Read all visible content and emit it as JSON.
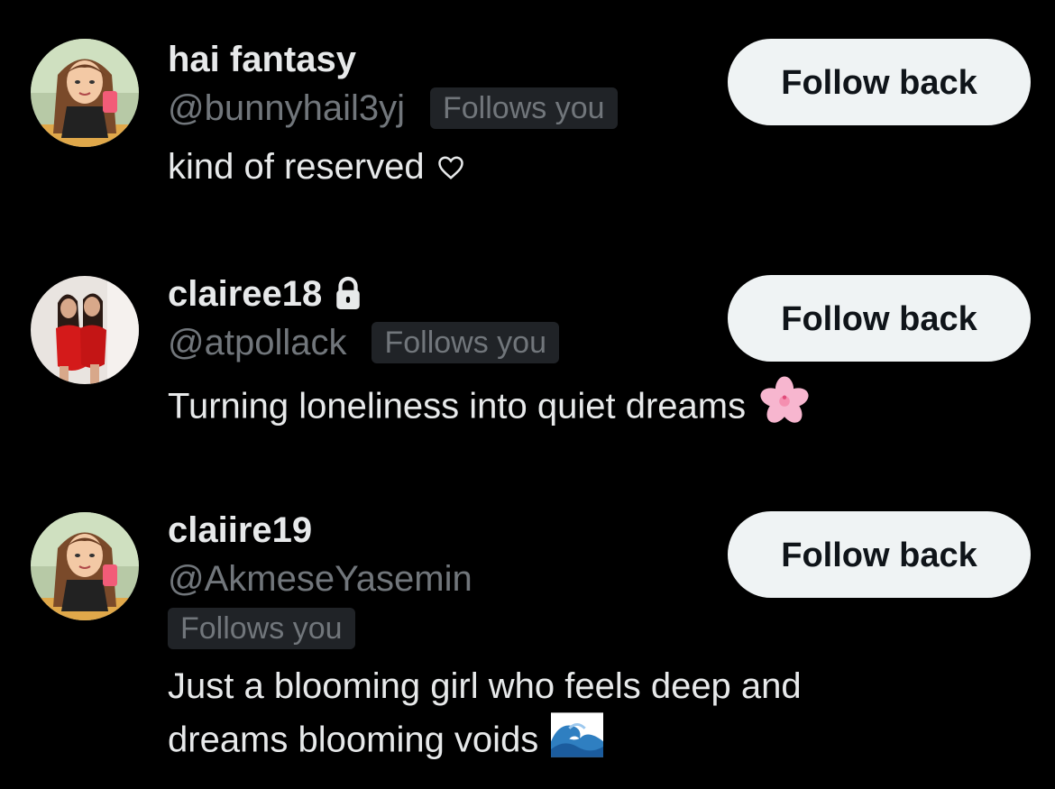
{
  "users": [
    {
      "display_name": "hai fantasy",
      "handle": "@bunnyhail3yj",
      "follows_badge": "Follows you",
      "bio": "kind of reserved",
      "bio_icon": "heart-outline-icon",
      "follow_button": "Follow back",
      "locked": false,
      "avatar": "cartoon-girl-avatar"
    },
    {
      "display_name": "clairee18",
      "handle": "@atpollack",
      "follows_badge": "Follows you",
      "bio": "Turning loneliness into quiet dreams",
      "bio_icon": "cherry-blossom-icon",
      "follow_button": "Follow back",
      "locked": true,
      "avatar": "photo-avatar"
    },
    {
      "display_name": "claiire19",
      "handle": "@AkmeseYasemin",
      "follows_badge": "Follows you",
      "bio_line1": "Just a blooming girl who feels deep and",
      "bio_line2": "dreams blooming voids",
      "bio_icon": "wave-icon",
      "follow_button": "Follow back",
      "locked": false,
      "avatar": "cartoon-girl-avatar"
    }
  ],
  "colors": {
    "background": "#000000",
    "primary_text": "#e7e9ea",
    "secondary_text": "#71767b",
    "badge_background": "#202327",
    "button_background": "#eff3f4",
    "button_text": "#0f1419"
  }
}
